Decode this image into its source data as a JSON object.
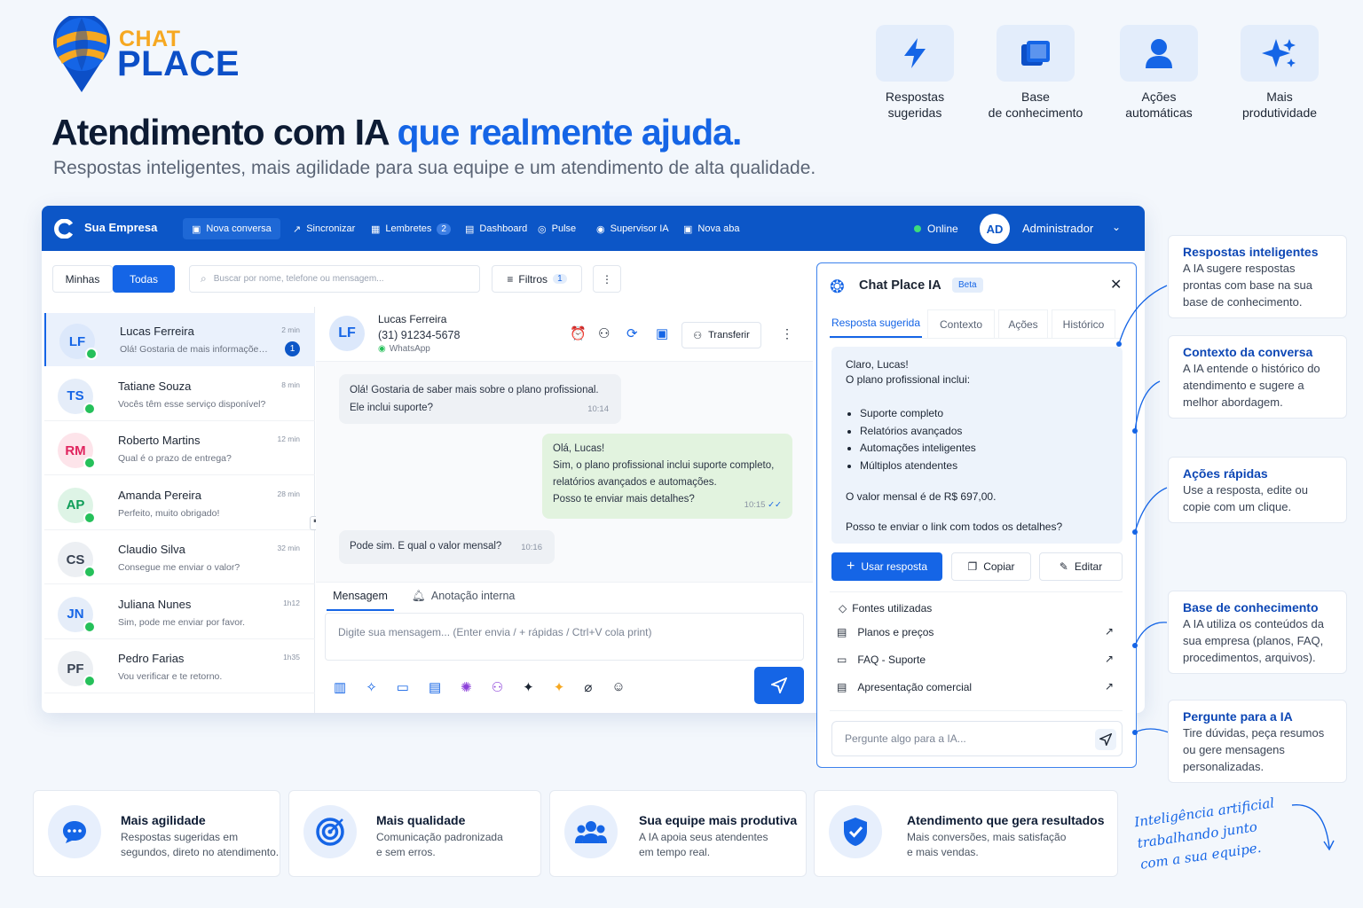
{
  "brand": {
    "chat": "CHAT",
    "place": "PLACE"
  },
  "headline": {
    "main": "Atendimento com IA ",
    "highlight": "que realmente ajuda."
  },
  "subhead": "Respostas inteligentes, mais agilidade para sua equipe e um atendimento de alta qualidade.",
  "features": [
    {
      "icon": "lightning-icon",
      "l1": "Respostas",
      "l2": "sugeridas"
    },
    {
      "icon": "book-icon",
      "l1": "Base",
      "l2": "de conhecimento"
    },
    {
      "icon": "user-icon",
      "l1": "Ações",
      "l2": "automáticas"
    },
    {
      "icon": "sparkle-icon",
      "l1": "Mais",
      "l2": "produtividade"
    }
  ],
  "topbar": {
    "company": "Sua Empresa",
    "nav": [
      "Nova conversa",
      "Sincronizar",
      "Lembretes",
      "Dashboard",
      "Pulse",
      "Supervisor IA",
      "Nova aba"
    ],
    "reminders_count": "2",
    "status": "Online",
    "avatar": "AD",
    "user": "Administrador"
  },
  "list": {
    "tabs": [
      "Minhas",
      "Todas"
    ],
    "search_placeholder": "Buscar por nome, telefone ou mensagem...",
    "filters": "Filtros",
    "filters_count": "1",
    "items": [
      {
        "initials": "LF",
        "name": "Lucas Ferreira",
        "msg": "Olá! Gostaria de mais informações...",
        "time": "2 min",
        "unread": "1",
        "color": "#1565e6",
        "bg": "#dce8fb"
      },
      {
        "initials": "TS",
        "name": "Tatiane Souza",
        "msg": "Vocês têm esse serviço disponível?",
        "time": "8 min",
        "color": "#1565e6",
        "bg": "#e5edf9"
      },
      {
        "initials": "RM",
        "name": "Roberto Martins",
        "msg": "Qual é o prazo de entrega?",
        "time": "12 min",
        "color": "#e0245e",
        "bg": "#fde4ea"
      },
      {
        "initials": "AP",
        "name": "Amanda Pereira",
        "msg": "Perfeito, muito obrigado!",
        "time": "28 min",
        "color": "#0f9d58",
        "bg": "#def4e6"
      },
      {
        "initials": "CS",
        "name": "Claudio Silva",
        "msg": "Consegue me enviar o valor?",
        "time": "32 min",
        "color": "#374151",
        "bg": "#eceff3"
      },
      {
        "initials": "JN",
        "name": "Juliana Nunes",
        "msg": "Sim, pode me enviar por favor.",
        "time": "1h12",
        "color": "#1565e6",
        "bg": "#e5edf9"
      },
      {
        "initials": "PF",
        "name": "Pedro Farias",
        "msg": "Vou verificar e te retorno.",
        "time": "1h35",
        "color": "#374151",
        "bg": "#eceff3"
      }
    ]
  },
  "chat": {
    "initials": "LF",
    "name": "Lucas Ferreira",
    "phone": "(31) 91234-5678",
    "channel": "WhatsApp",
    "transfer": "Transferir",
    "messages": [
      {
        "l1": "Olá! Gostaria de saber mais sobre o plano profissional.",
        "l2": "Ele inclui suporte?",
        "time": "10:14"
      },
      {
        "l1": "Olá, Lucas!",
        "l2": "Sim, o plano profissional inclui suporte completo,",
        "l3": "relatórios avançados e automações.",
        "l4": "Posso te enviar mais detalhes?",
        "time": "10:15"
      },
      {
        "l1": "Pode sim. E qual o valor mensal?",
        "time": "10:16"
      }
    ],
    "compose_tabs": [
      "Mensagem",
      "Anotação interna"
    ],
    "compose_placeholder": "Digite sua mensagem... (Enter envia / + rápidas / Ctrl+V cola print)"
  },
  "ai": {
    "title": "Chat Place IA",
    "badge": "Beta",
    "tabs": [
      "Resposta sugerida",
      "Contexto",
      "Ações",
      "Histórico"
    ],
    "reply": {
      "greet": "Claro, Lucas!",
      "intro": "O plano profissional inclui:",
      "bullets": [
        "Suporte completo",
        "Relatórios avançados",
        "Automações inteligentes",
        "Múltiplos atendentes"
      ],
      "price": "O valor mensal é de R$ 697,00.",
      "close": "Posso te enviar o link com todos os detalhes?"
    },
    "buttons": [
      "Usar resposta",
      "Copiar",
      "Editar"
    ],
    "sources_title": "Fontes utilizadas",
    "sources": [
      "Planos e preços",
      "FAQ - Suporte",
      "Apresentação comercial"
    ],
    "ask_placeholder": "Pergunte algo para a IA..."
  },
  "callouts": [
    {
      "title": "Respostas inteligentes",
      "desc": "A IA sugere respostas prontas com base na sua base de conhecimento."
    },
    {
      "title": "Contexto da conversa",
      "desc": "A IA entende o histórico do atendimento e sugere a melhor abordagem."
    },
    {
      "title": "Ações rápidas",
      "desc": "Use a resposta, edite ou copie com um clique."
    },
    {
      "title": "Base de conhecimento",
      "desc": "A IA utiliza os conteúdos da sua empresa (planos, FAQ, procedimentos, arquivos)."
    },
    {
      "title": "Pergunte para a IA",
      "desc": "Tire dúvidas, peça resumos ou gere mensagens personalizadas."
    }
  ],
  "benefits": [
    {
      "icon": "chat-bubble-icon",
      "title": "Mais agilidade",
      "d1": "Respostas sugeridas em",
      "d2": "segundos, direto no atendimento."
    },
    {
      "icon": "target-icon",
      "title": "Mais qualidade",
      "d1": "Comunicação padronizada",
      "d2": "e sem erros."
    },
    {
      "icon": "team-icon",
      "title": "Sua equipe mais produtiva",
      "d1": "A IA apoia seus atendentes",
      "d2": "em tempo real."
    },
    {
      "icon": "shield-check-icon",
      "title": "Atendimento que gera resultados",
      "d1": "Mais conversões, mais satisfação",
      "d2": "e mais vendas."
    }
  ],
  "tagline": {
    "l1": "Inteligência artificial",
    "l2": "trabalhando junto",
    "l3": "com a sua equipe."
  },
  "colors": {
    "primary": "#0c56c7",
    "accent": "#1565e6",
    "brand_orange": "#f6a821",
    "whatsapp": "#25c05a"
  }
}
